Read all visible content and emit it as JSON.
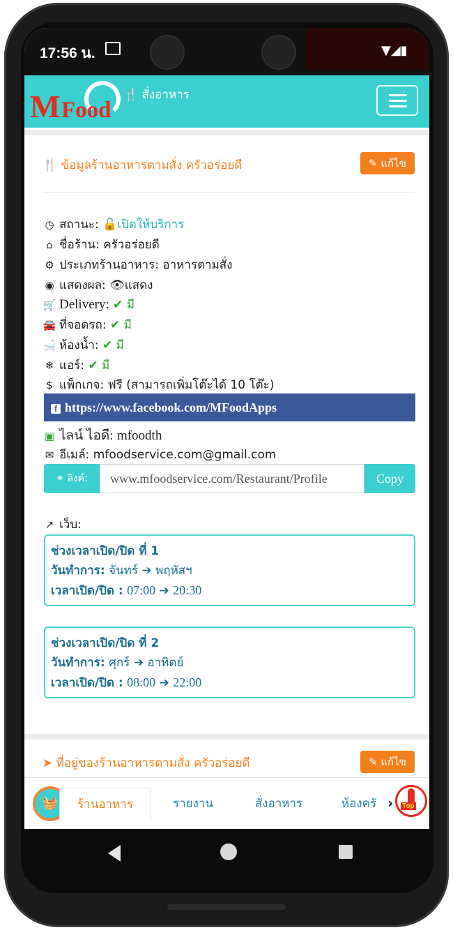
{
  "status_bar": {
    "time": "17:56 น."
  },
  "navbar": {
    "logo_m": "M",
    "logo_food": "Food",
    "brand_icon": "utensils-icon",
    "brand_text": "สั่งอาหาร",
    "menu_icon": "hamburger-icon"
  },
  "restaurant_card": {
    "title": "ข้อมูลร้านอาหารตามสั่ง ครัวอร่อยดี",
    "edit_label": "แก้ไข",
    "status_label": "สถานะ:",
    "status_value": "เปิดให้บริการ",
    "name_label": "ชื่อร้าน:",
    "name_value": "ครัวอร่อยดี",
    "type_label": "ประเภทร้านอาหาร:",
    "type_value": "อาหารตามสั่ง",
    "display_label": "แสดงผล:",
    "display_value": "แสดง",
    "delivery_label": "Delivery:",
    "delivery_value": "มี",
    "parking_label": "ที่จอดรถ:",
    "parking_value": "มี",
    "toilet_label": "ห้องน้ำ:",
    "toilet_value": "มี",
    "aircon_label": "แอร์:",
    "aircon_value": "มี",
    "package_label": "แพ็กเกจ:",
    "package_value": "ฟรี (สามารถเพิ่มโต๊ะได้ 10 โต๊ะ)",
    "facebook_url": "https://www.facebook.com/MFoodApps",
    "line_label": "ไลน์ ไอดี:",
    "line_value": "mfoodth",
    "email_label": "อีเมล์:",
    "email_value": "mfoodservice.com@gmail.com",
    "link_label": "ลิงค์:",
    "link_value": "www.mfoodservice.com/Restaurant/Profile",
    "copy_label": "Copy",
    "web_label": "เว็บ:",
    "hours": [
      {
        "title": "ช่วงเวลาเปิด/ปิด ที่ 1",
        "days_label": "วันทำการ:",
        "day_from": "จันทร์",
        "day_to": "พฤหัสฯ",
        "time_label": "เวลาเปิด/ปิด :",
        "time_from": "07:00",
        "time_to": "20:30"
      },
      {
        "title": "ช่วงเวลาเปิด/ปิด ที่ 2",
        "days_label": "วันทำการ:",
        "day_from": "ศุกร์",
        "day_to": "อาทิตย์",
        "time_label": "เวลาเปิด/ปิด :",
        "time_from": "08:00",
        "time_to": "22:00"
      }
    ]
  },
  "address_card": {
    "title": "ที่อยู่ของร้านอาหารตามสั่ง ครัวอร่อยดี",
    "edit_label": "แก้ไข"
  },
  "bottom_nav": {
    "tabs": [
      "ร้านอาหาร",
      "รายงาน",
      "สั่งอาหาร",
      "ห้องครั"
    ],
    "active_tab": "ร้านอาหาร",
    "top_label": "Top"
  },
  "colors": {
    "navbar": "#3ccfcf",
    "accent": "#f47f1d",
    "logo": "#e52c1f",
    "facebook": "#3b5998",
    "check": "#2ea12e"
  }
}
